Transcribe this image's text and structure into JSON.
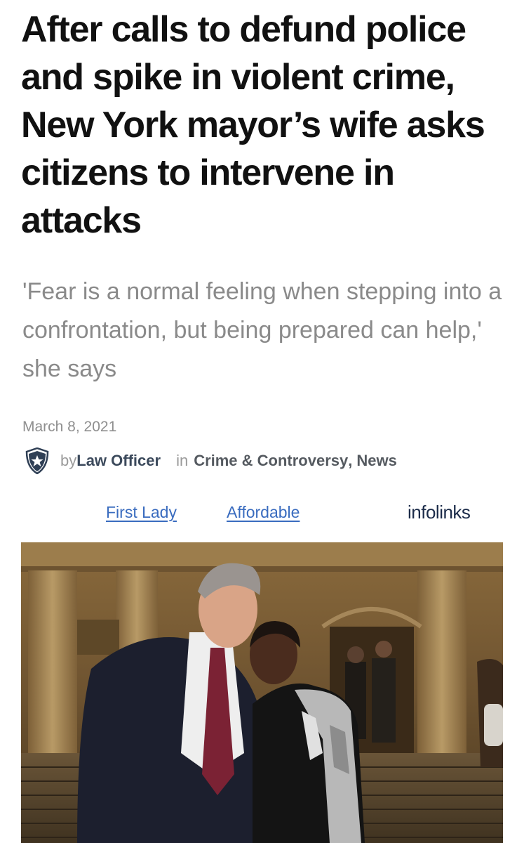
{
  "article": {
    "headline": "After calls to defund police and spike in violent crime, New York mayor’s wife asks citizens to intervene in attacks",
    "dek": "'Fear is a normal feeling when stepping into a confrontation, but being prepared can help,' she says",
    "date": "March 8, 2021",
    "byline": {
      "by_prefix": "by",
      "author": "Law Officer",
      "in_prefix": "in",
      "categories": [
        "Crime & Controversy",
        "News"
      ],
      "separator": ","
    }
  },
  "ads": {
    "links": [
      "First Lady",
      "Affordable"
    ],
    "brand": "infolinks"
  },
  "icons": {
    "author_badge": "shield-star-icon"
  },
  "colors": {
    "headline": "#111111",
    "dek": "#8a8a8a",
    "link": "#3a6cbf",
    "author": "#3c4a5c",
    "brand": "#1b2b49"
  }
}
